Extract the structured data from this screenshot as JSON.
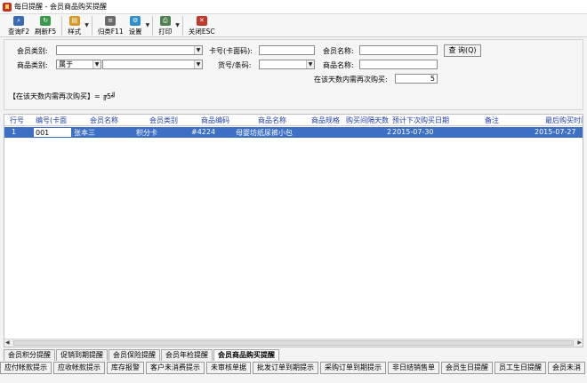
{
  "window": {
    "title": "每日提醒 - 会员商品购买提醒"
  },
  "toolbar": {
    "query_label": "查询F2",
    "refresh_label": "刷新F5",
    "style_label": "样式",
    "categorize_label": "归类F11",
    "settings_label": "设置",
    "print_label": "打印",
    "close_label": "关闭ESC"
  },
  "filters": {
    "member_type_label": "会员类别:",
    "card_no_label": "卡号(卡面码):",
    "member_name_label": "会员名称:",
    "query_button": "查 询(Q)",
    "product_type_label": "商品类别:",
    "product_type_value": "属于",
    "item_no_label": "货号/条码:",
    "product_name_label": "商品名称:",
    "repurchase_label": "在该天数内需再次购买:",
    "repurchase_value": "5"
  },
  "condition_text": "【在该天数内需再次购买】= ╔5╝",
  "table": {
    "columns": [
      "行号",
      "编号(卡面",
      "会员名称",
      "会员类别",
      "商品编码",
      "商品名称",
      "商品规格",
      "购买间隔天数",
      "预计下次购买日期",
      "备注",
      "最后购买时间"
    ],
    "rows": [
      {
        "row_no": "1",
        "code": "001",
        "member_name": "张本三",
        "member_type": "积分卡",
        "product_code": "#4224",
        "product_name": "母婴坊纸尿裤小包",
        "spec": "",
        "interval_days": "2",
        "next_date": "2015-07-30",
        "remark": "",
        "last_date": "2015-07-27"
      }
    ]
  },
  "tabs": [
    "会员积分提醒",
    "促销到期提醒",
    "会员保险提醒",
    "会员年检提醒",
    "会员商品购买提醒"
  ],
  "bottom_buttons": [
    "应付帐款提示",
    "应收帐款提示",
    "库存报警",
    "客户未消费提示",
    "未审核单据",
    "批发订单到期提示",
    "采购订单到期提示",
    "非日结销售单",
    "会员生日提醒",
    "员工生日提醒",
    "会员未消"
  ],
  "colors": {
    "selection": "#3d6fc4",
    "header_text": "#1f3fa5"
  }
}
